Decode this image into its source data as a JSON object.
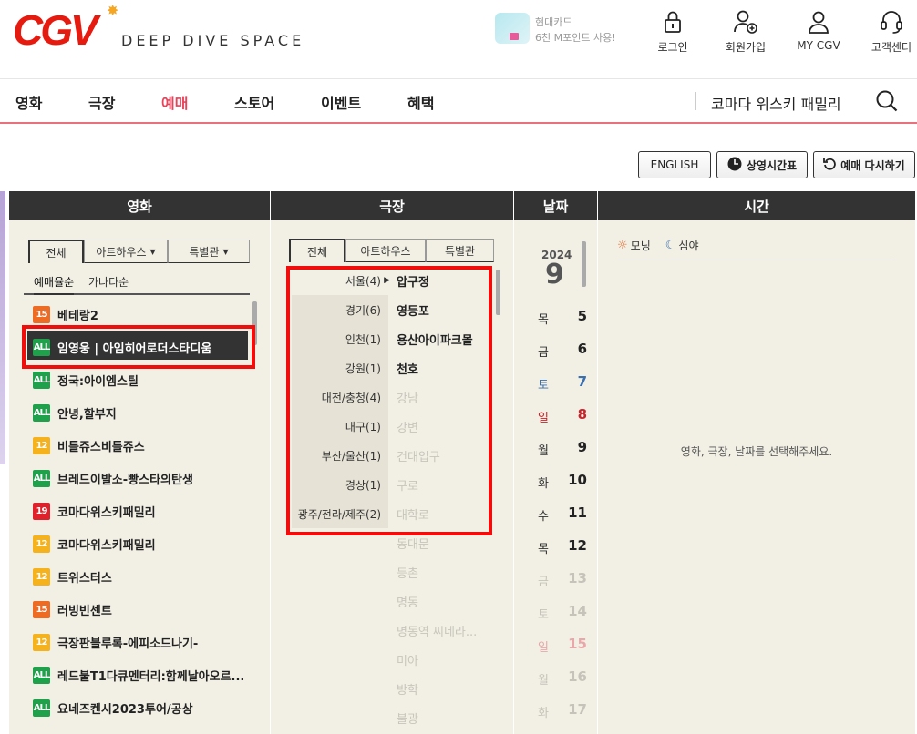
{
  "header": {
    "logo": "CGV",
    "tagline": "DEEP DIVE SPACE",
    "promo_line1": "현대카드",
    "promo_line2": "6천 M포인트 사용!",
    "utils": [
      "로그인",
      "회원가입",
      "MY CGV",
      "고객센터"
    ]
  },
  "nav": {
    "items": [
      "영화",
      "극장",
      "예매",
      "스토어",
      "이벤트",
      "혜택"
    ],
    "active": "예매",
    "search_text": "코마다 위스키 패밀리"
  },
  "actions": {
    "english": "ENGLISH",
    "timetable": "상영시간표",
    "restart": "예매 다시하기"
  },
  "columns": {
    "movie": "영화",
    "theater": "극장",
    "date": "날짜",
    "time": "시간"
  },
  "movie_panel": {
    "tabs": [
      "전체",
      "아트하우스",
      "특별관"
    ],
    "sorts": [
      "예매율순",
      "가나다순"
    ],
    "movies": [
      {
        "rating": "15",
        "title": "베테랑2"
      },
      {
        "rating": "ALL",
        "title": "임영웅 | 아임히어로더스타디움"
      },
      {
        "rating": "ALL",
        "title": "정국:아이엠스틸"
      },
      {
        "rating": "ALL",
        "title": "안녕,할부지"
      },
      {
        "rating": "12",
        "title": "비틀쥬스비틀쥬스"
      },
      {
        "rating": "ALL",
        "title": "브레드이발소-빵스타의탄생"
      },
      {
        "rating": "19",
        "title": "코마다위스키패밀리"
      },
      {
        "rating": "12",
        "title": "코마다위스키패밀리"
      },
      {
        "rating": "12",
        "title": "트위스터스"
      },
      {
        "rating": "15",
        "title": "러빙빈센트"
      },
      {
        "rating": "12",
        "title": "극장판블루록-에피소드나기-"
      },
      {
        "rating": "ALL",
        "title": "레드불T1다큐멘터리:함께날아오르..."
      },
      {
        "rating": "ALL",
        "title": "요네즈켄시2023투어/공상"
      }
    ]
  },
  "theater_panel": {
    "tabs": [
      "전체",
      "아트하우스",
      "특별관"
    ],
    "regions": [
      "서울(4)",
      "경기(6)",
      "인천(1)",
      "강원(1)",
      "대전/충청(4)",
      "대구(1)",
      "부산/울산(1)",
      "경상(1)",
      "광주/전라/제주(2)"
    ],
    "theaters": [
      {
        "name": "압구정",
        "available": true
      },
      {
        "name": "영등포",
        "available": true
      },
      {
        "name": "용산아이파크몰",
        "available": true
      },
      {
        "name": "천호",
        "available": true
      },
      {
        "name": "강남",
        "available": false
      },
      {
        "name": "강변",
        "available": false
      },
      {
        "name": "건대입구",
        "available": false
      },
      {
        "name": "구로",
        "available": false
      },
      {
        "name": "대학로",
        "available": false
      },
      {
        "name": "동대문",
        "available": false
      },
      {
        "name": "등촌",
        "available": false
      },
      {
        "name": "명동",
        "available": false
      },
      {
        "name": "명동역 씨네라...",
        "available": false
      },
      {
        "name": "미아",
        "available": false
      },
      {
        "name": "방학",
        "available": false
      },
      {
        "name": "불광",
        "available": false
      }
    ]
  },
  "date_panel": {
    "year": "2024",
    "month": "9",
    "days": [
      {
        "dow": "목",
        "day": "5",
        "type": "normal"
      },
      {
        "dow": "금",
        "day": "6",
        "type": "normal"
      },
      {
        "dow": "토",
        "day": "7",
        "type": "sat"
      },
      {
        "dow": "일",
        "day": "8",
        "type": "sun"
      },
      {
        "dow": "월",
        "day": "9",
        "type": "normal"
      },
      {
        "dow": "화",
        "day": "10",
        "type": "normal"
      },
      {
        "dow": "수",
        "day": "11",
        "type": "normal"
      },
      {
        "dow": "목",
        "day": "12",
        "type": "normal"
      },
      {
        "dow": "금",
        "day": "13",
        "type": "dim"
      },
      {
        "dow": "토",
        "day": "14",
        "type": "dim"
      },
      {
        "dow": "일",
        "day": "15",
        "type": "dimsun"
      },
      {
        "dow": "월",
        "day": "16",
        "type": "dim"
      },
      {
        "dow": "화",
        "day": "17",
        "type": "dim"
      }
    ]
  },
  "time_panel": {
    "morning": "모닝",
    "night": "심야",
    "placeholder": "영화, 극장, 날짜를 선택해주세요."
  },
  "colors": {
    "brand_red": "#e71a0f",
    "nav_active": "#e8435a",
    "panel_bg": "#f2f0e5",
    "highlight_box": "#f20d0d",
    "saturday": "#3a6fb0",
    "sunday": "#c8222a"
  }
}
